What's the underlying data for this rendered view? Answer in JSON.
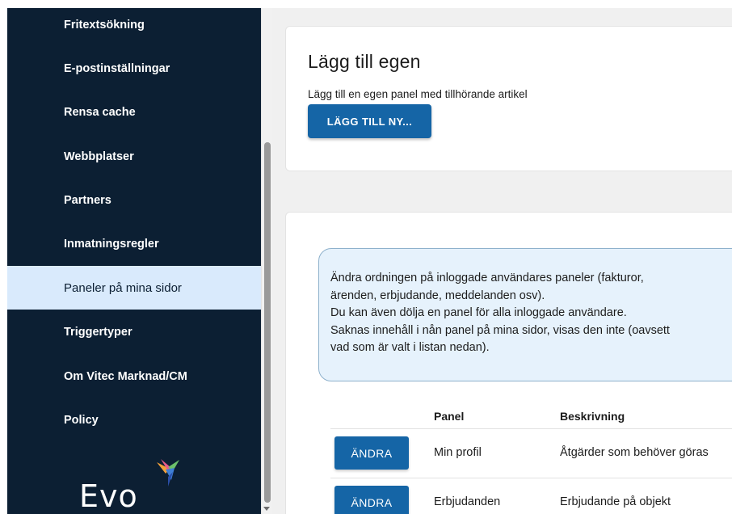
{
  "sidebar": {
    "items": [
      {
        "label": "Fritextsökning",
        "active": false
      },
      {
        "label": "E-postinställningar",
        "active": false
      },
      {
        "label": "Rensa cache",
        "active": false
      },
      {
        "label": "Webbplatser",
        "active": false
      },
      {
        "label": "Partners",
        "active": false
      },
      {
        "label": "Inmatningsregler",
        "active": false
      },
      {
        "label": "Paneler på mina sidor",
        "active": true
      },
      {
        "label": "Triggertyper",
        "active": false
      },
      {
        "label": "Om Vitec Marknad/CM",
        "active": false
      },
      {
        "label": "Policy",
        "active": false
      }
    ],
    "logo_text": "Evo",
    "colors": {
      "background": "#0c1f33",
      "active_bg": "#d9eafc"
    }
  },
  "add_own": {
    "title": "Lägg till egen",
    "description": "Lägg till en egen panel med tillhörande artikel",
    "button_label": "LÄGG TILL NY..."
  },
  "info": {
    "lines": [
      "Ändra ordningen på inloggade användares paneler (fakturor,",
      "ärenden, erbjudande, meddelanden osv).",
      "Du kan även dölja en panel för alla inloggade användare.",
      "Saknas innehåll i nån panel på mina sidor, visas den inte (oavsett",
      "vad som är valt i listan nedan)."
    ]
  },
  "table": {
    "headers": {
      "panel": "Panel",
      "description": "Beskrivning"
    },
    "rows": [
      {
        "button": "ÄNDRA",
        "panel": "Min profil",
        "description": "Åtgärder som behöver göras"
      },
      {
        "button": "ÄNDRA",
        "panel": "Erbjudanden",
        "description": "Erbjudande på objekt"
      }
    ]
  },
  "colors": {
    "primary": "#1565a6",
    "info_bg": "#e6f2fc",
    "main_bg": "#f0f0f0"
  }
}
